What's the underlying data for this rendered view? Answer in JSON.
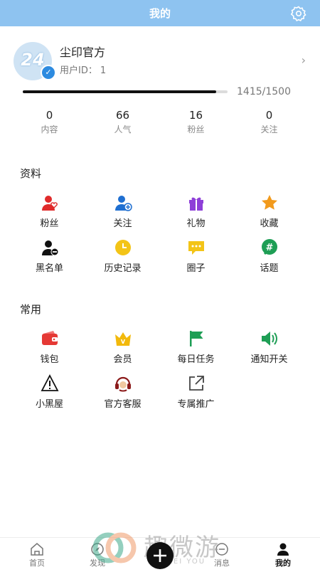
{
  "header": {
    "title": "我的",
    "settings_icon": "gear-icon"
  },
  "profile": {
    "avatar_text": "24",
    "verified_icon": "check-icon",
    "name": "尘印官方",
    "id_label": "用户ID：",
    "id_value": "1"
  },
  "progress": {
    "current": 1415,
    "max": 1500,
    "text": "1415/1500",
    "fraction": 0.943
  },
  "stats": [
    {
      "value": "0",
      "label": "内容"
    },
    {
      "value": "66",
      "label": "人气"
    },
    {
      "value": "16",
      "label": "粉丝"
    },
    {
      "value": "0",
      "label": "关注"
    }
  ],
  "sections": {
    "data_title": "资料",
    "data_items": [
      {
        "label": "粉丝",
        "icon": "fans-icon",
        "color": "#e02b2b"
      },
      {
        "label": "关注",
        "icon": "follow-icon",
        "color": "#1f6fd1"
      },
      {
        "label": "礼物",
        "icon": "gift-icon",
        "color": "#8e3fd8"
      },
      {
        "label": "收藏",
        "icon": "star-icon",
        "color": "#f29a1c"
      },
      {
        "label": "黑名单",
        "icon": "blacklist-icon",
        "color": "#111111"
      },
      {
        "label": "历史记录",
        "icon": "clock-icon",
        "color": "#f3c417"
      },
      {
        "label": "圈子",
        "icon": "chat-bubble-icon",
        "color": "#f3c417"
      },
      {
        "label": "话题",
        "icon": "hashtag-icon",
        "color": "#1e9e55"
      }
    ],
    "common_title": "常用",
    "common_items": [
      {
        "label": "钱包",
        "icon": "wallet-icon",
        "color": "#e53935"
      },
      {
        "label": "会员",
        "icon": "crown-icon",
        "color": "#f2b90c"
      },
      {
        "label": "每日任务",
        "icon": "flag-icon",
        "color": "#1e9e55"
      },
      {
        "label": "通知开关",
        "icon": "speaker-icon",
        "color": "#1e9e55"
      },
      {
        "label": "小黑屋",
        "icon": "warning-icon",
        "color": "#111111"
      },
      {
        "label": "官方客服",
        "icon": "headset-icon",
        "color": "#8b1a1a"
      },
      {
        "label": "专属推广",
        "icon": "share-icon",
        "color": "#444444"
      }
    ]
  },
  "tabbar": [
    {
      "label": "首页",
      "icon": "home-icon"
    },
    {
      "label": "发现",
      "icon": "compass-icon"
    },
    {
      "label": "消息",
      "icon": "message-icon"
    },
    {
      "label": "我的",
      "icon": "user-icon",
      "active": true
    }
  ],
  "fab_icon": "plus-icon",
  "watermark": {
    "title": "趣微游",
    "sub": "WEI YOU"
  }
}
